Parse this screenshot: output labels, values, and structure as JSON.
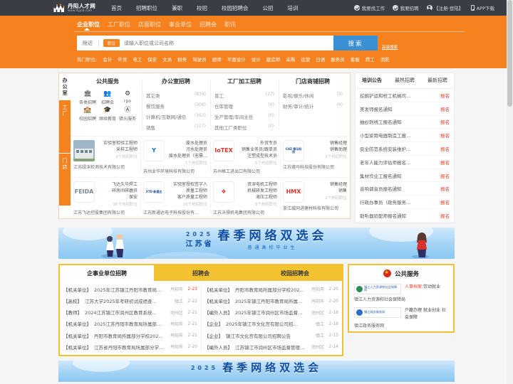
{
  "site": {
    "logo_cn": "丹阳人才网",
    "logo_en": "www.dyjob.com"
  },
  "topnav": {
    "items": [
      "首页",
      "招聘职位",
      "兼职",
      "校招",
      "校园招聘会",
      "公招",
      "培训"
    ],
    "right": [
      {
        "icon": "check-circle-icon",
        "label": "我要找工作"
      },
      {
        "icon": "check-circle-icon",
        "label": "我要招聘"
      },
      {
        "icon": "user-icon",
        "label": "【注册·登陆】"
      },
      {
        "icon": "phone-icon",
        "label": "APP下载"
      }
    ]
  },
  "search": {
    "tabs": [
      "企业职位",
      "工厂职位",
      "店面职位",
      "事业单位",
      "招聘会",
      "职讯"
    ],
    "active_tab": "企业职位",
    "near_label": "附近",
    "type_tag": "职位",
    "placeholder": "请输入职位或公司名称",
    "button": "搜索",
    "advanced": "高级搜索",
    "hot_label": "热门职位:",
    "hot_words": [
      "会计",
      "外贸",
      "电工",
      "保安",
      "文员",
      "财务",
      "驾驶员",
      "厨师",
      "平面设计",
      "设计",
      "建造师",
      "采购",
      "运营",
      "日语",
      "服务员",
      "客服",
      "焊工",
      "消防"
    ]
  },
  "jobpanel": {
    "vtabs": [
      {
        "label": "办公室",
        "active": true
      },
      {
        "label": "工厂",
        "active": false
      },
      {
        "label": "门店",
        "active": false
      }
    ],
    "columns": [
      {
        "title": "公共服务",
        "type": "icons",
        "items": [
          {
            "icon": "building-icon",
            "glyph": "🏛",
            "label": "各类招聘"
          },
          {
            "icon": "fair-icon",
            "glyph": "👥",
            "label": "招聘会"
          },
          {
            "icon": "rpo-icon",
            "glyph": "⚙",
            "label": "rpo"
          },
          {
            "icon": "campus-icon",
            "glyph": "🏫",
            "label": "校园招聘"
          },
          {
            "icon": "education-icon",
            "glyph": "🎓",
            "label": "继续教育"
          },
          {
            "icon": "headhunt-icon",
            "glyph": "Ⓐ",
            "label": "猎头服务"
          }
        ]
      },
      {
        "title": "办公室招聘",
        "type": "list",
        "items": [
          {
            "name": "其它类",
            "count": "(839)"
          },
          {
            "name": "餐饮服务",
            "count": "(306)"
          },
          {
            "name": "计算机/互联网/通信",
            "count": "(162)"
          },
          {
            "name": "销售",
            "count": "(117)"
          }
        ]
      },
      {
        "title": "工厂加工招聘",
        "type": "list",
        "items": [
          {
            "name": "普工",
            "count": "(27)"
          },
          {
            "name": "仓库管理",
            "count": "(0)"
          },
          {
            "name": "生产管理/车间主任",
            "count": "(0)"
          },
          {
            "name": "其他工厂类职位",
            "count": "(0)"
          }
        ]
      },
      {
        "title": "门店商铺招聘",
        "type": "list",
        "items": [
          {
            "name": "影视/娱乐/休闲",
            "count": "(9)"
          },
          {
            "name": "财务/审计/统计",
            "count": "(9)"
          }
        ]
      }
    ],
    "companies_row1": [
      {
        "logo_type": "photo",
        "logo_text": "",
        "jobs": [
          "实验室检验工程师",
          "采样工程师"
        ],
        "more": "3个热招职位",
        "name": "江苏绿沫检测技术有限公司"
      },
      {
        "logo_type": "mark",
        "logo_text": "Y",
        "logo_color": "#1a73b7",
        "jobs": [
          "废水处理员",
          "污水处理员",
          "废水处理员（无需…"
        ],
        "more": "5个热招职位",
        "name": "苏州业华环境科技有限公司"
      },
      {
        "logo_type": "mark",
        "logo_text": "IoTEX",
        "logo_color": "#d9342b",
        "jobs": [
          "外贸专员",
          "销售业务员/跟单员",
          "注塑成型技术员"
        ],
        "more": "5个热招职位",
        "name": "苏州格工进出口有限公司"
      },
      {
        "logo_type": "mark",
        "logo_text": "CHZ 德马科技",
        "logo_color": "#1b4f9c",
        "jobs": [
          "销售经理",
          "销售助理"
        ],
        "more": "2个热招职位",
        "name": "江苏德马科技股份有限公司"
      }
    ],
    "companies_row2": [
      {
        "logo_type": "mark",
        "logo_text": "FEIDA",
        "logo_color": "#7a8794",
        "jobs": [
          "飞达久华焊工",
          "碎房间研磨员",
          "保安"
        ],
        "more": "36个热招职位",
        "name": "江苏飞达控股集团有限公司"
      },
      {
        "logo_type": "mark",
        "logo_text": "XTD 新通达",
        "logo_color": "#1b4f9c",
        "jobs": [
          "实验室授权签字人",
          "质量工程师",
          "客户质量工程师"
        ],
        "more": "16个热招职位",
        "name": "江苏新通达电子科技股份有…"
      },
      {
        "logo_type": "mark",
        "logo_text": "❖",
        "logo_color": "#d9342b",
        "jobs": [
          "资深电机工程师",
          "机械研发工程师",
          "液压工程师"
        ],
        "more": "8个热招职位",
        "name": "江苏沃得机电集团有限公司"
      },
      {
        "logo_type": "mark",
        "logo_text": "HMX",
        "logo_color": "#d9342b",
        "jobs": [
          "销售经理",
          "销售"
        ],
        "more": "2个热招职位",
        "name": "浙江威同进建材科技有限公司"
      }
    ]
  },
  "newspanel": {
    "tabs": [
      "培训公告",
      "最热招聘",
      "最新招聘"
    ],
    "active_tab": "培训公告",
    "btn_label": "报名",
    "items": [
      "挖掘铲运和桩工机械司…",
      "美发师报名通知",
      "抽纱刺绣工报名通知",
      "小型家用电器制造工报…",
      "安全防范系统安装维护…",
      "老年人能力评估师报名…",
      "集材作业工报名通知",
      "音响调音员报名通知",
      "行政办事员（政务服务…",
      "助听器验配师报名通知"
    ]
  },
  "banner": {
    "year": "2025",
    "province": "江苏省",
    "title": "春季网络双选会",
    "subtitle": "普通高校毕业生"
  },
  "listpanel": {
    "tabs": [
      "企事业单位招聘",
      "招聘会",
      "校园招聘会"
    ],
    "active_tab": "企事业单位招聘",
    "left_items": [
      {
        "cat": "【机关单位】",
        "title": "2025年江苏镇江丹阳市教育局所…",
        "area": "丹阳市",
        "date": "2-23",
        "hot": true
      },
      {
        "cat": "【高校】",
        "title": "江苏大学2025年考研初试成绩查…",
        "area": "镇江",
        "date": "2-22",
        "hot": false
      },
      {
        "cat": "【教师】",
        "title": "2024江苏镇江市润州区教育系统…",
        "area": "润州区",
        "date": "2-21",
        "hot": false
      },
      {
        "cat": "【机关单位】",
        "title": "2025江苏丹阳市教育局所属部分…",
        "area": "丹阳市",
        "date": "2-21",
        "hot": false
      },
      {
        "cat": "【机关单位】",
        "title": "丹阳市教育局所属部分学校2025…",
        "area": "丹阳市",
        "date": "2-21",
        "hot": false
      },
      {
        "cat": "【机关单位】",
        "title": "江苏省丹阳市教育局所属部分学…",
        "area": "丹阳市",
        "date": "2-20",
        "hot": false
      }
    ],
    "right_items": [
      {
        "cat": "【机关单位】",
        "title": "丹阳市教育局所属部分学校2025…",
        "area": "丹阳市",
        "date": "2-20",
        "hot": false
      },
      {
        "cat": "【机关单位】",
        "title": "2025年镇江丹阳市教育局所属部…",
        "area": "丹阳市",
        "date": "2-20",
        "hot": false
      },
      {
        "cat": "【编外人员】",
        "title": "2025年镇江市润州区市场监督管…",
        "area": "润州区",
        "date": "2-18",
        "hot": false
      },
      {
        "cat": "【企业】",
        "title": "2025年镇江市文化宫有限公司招…",
        "area": "镇江",
        "date": "2-18",
        "hot": false
      },
      {
        "cat": "【企业】",
        "title": "镇江市文化宫有限公司招聘公告",
        "area": "镇江",
        "date": "2-15",
        "hot": false
      },
      {
        "cat": "【编外人员】",
        "title": "江苏镇江市润州区市场监督管理…",
        "area": "润州区",
        "date": "2-14",
        "hot": false
      }
    ]
  },
  "pubpanel": {
    "title": "公共服务",
    "entries": [
      {
        "logo_text": "镇江人力资源和社会保障网",
        "logo_color": "#2e8b57",
        "links": [
          "人事档案",
          "劳动就业"
        ],
        "highlight_index": 0,
        "caption": "镇江人力资源和社会保障局"
      },
      {
        "logo_text": "镇江政务服务网",
        "logo_color": "#2b6fc2",
        "links": [
          "户籍办理",
          "就业创业",
          "社会保障"
        ],
        "highlight_index": -1,
        "caption": "镇江政务服务网"
      }
    ]
  },
  "banner2": {
    "year": "2025",
    "title": "春季网络双选会"
  }
}
